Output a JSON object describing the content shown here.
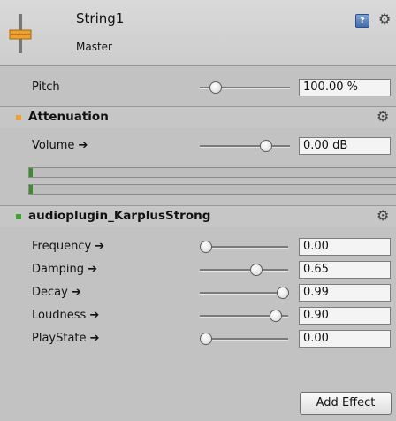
{
  "header": {
    "title": "String1",
    "subtitle": "Master",
    "help_icon_glyph": "?",
    "icons": [
      "fader-icon",
      "help-icon",
      "gear-icon"
    ]
  },
  "pitch": {
    "label": "Pitch",
    "value": "100.00 %",
    "slider_fraction": 0.12
  },
  "attenuation": {
    "title": "Attenuation",
    "bullet_color": "#f0a030",
    "volume": {
      "label": "Volume ➔",
      "value": "0.00 dB",
      "slider_fraction": 0.75
    },
    "meters": [
      {
        "level": 0.01
      },
      {
        "level": 0.01
      }
    ],
    "meter_color": "#3a8e2c"
  },
  "plugin": {
    "title": "audioplugin_KarplusStrong",
    "bullet_color": "#3aa82e",
    "params": [
      {
        "label": "Frequency ➔",
        "value": "0.00",
        "slider_fraction": 0.0
      },
      {
        "label": "Damping ➔",
        "value": "0.65",
        "slider_fraction": 0.65
      },
      {
        "label": "Decay ➔",
        "value": "0.99",
        "slider_fraction": 0.99
      },
      {
        "label": "Loudness ➔",
        "value": "0.90",
        "slider_fraction": 0.9
      },
      {
        "label": "PlayState ➔",
        "value": "0.00",
        "slider_fraction": 0.0
      }
    ]
  },
  "footer": {
    "add_effect_label": "Add Effect"
  }
}
